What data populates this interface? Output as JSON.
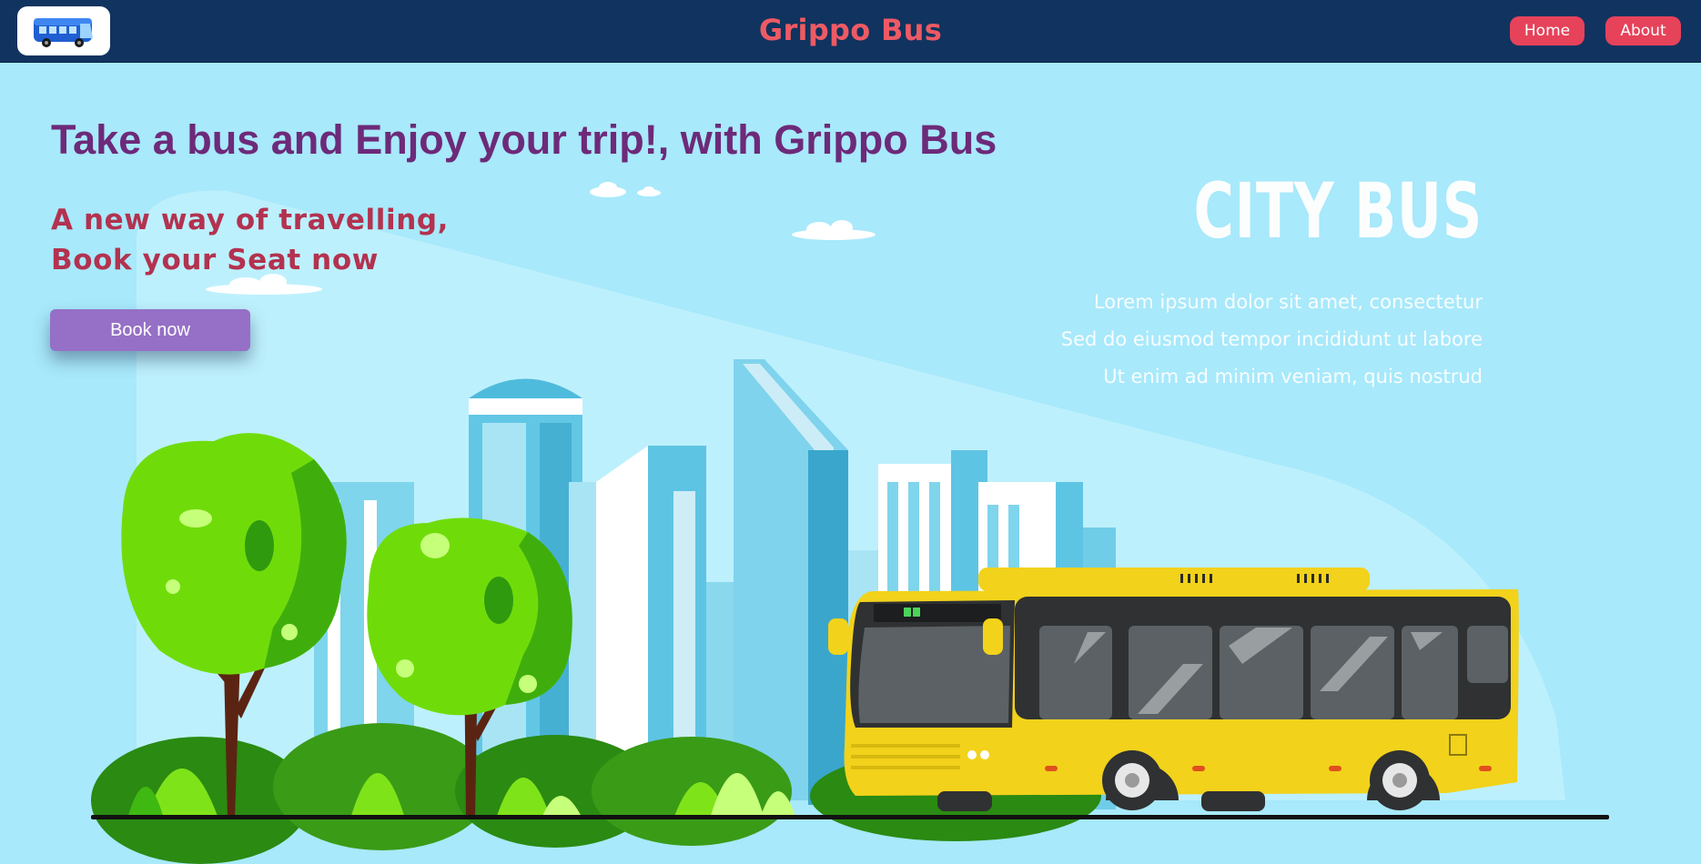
{
  "navbar": {
    "brand": "Grippo Bus",
    "logo_icon": "bus-logo-icon",
    "links": [
      {
        "label": "Home"
      },
      {
        "label": "About"
      }
    ]
  },
  "hero": {
    "title": "Take a bus and Enjoy your trip!, with Grippo Bus",
    "subtitle_lines": [
      "A new way of travelling,",
      "Book your Seat now"
    ],
    "cta_label": "Book now"
  },
  "illustration": {
    "heading": "CITY BUS",
    "lines": [
      "Lorem ipsum dolor sit amet, consectetur",
      "Sed do eiusmod tempor incididunt ut labore",
      "Ut enim ad minim veniam, quis nostrud"
    ]
  },
  "colors": {
    "navbar": "#11335f",
    "brand_text": "#ee5a64",
    "nav_button": "#e6425a",
    "background": "#a8e9fb",
    "hero_title": "#6d2a79",
    "hero_subtitle": "#b3324f",
    "cta_button": "#9570c6",
    "bus": "#f2d21b"
  }
}
